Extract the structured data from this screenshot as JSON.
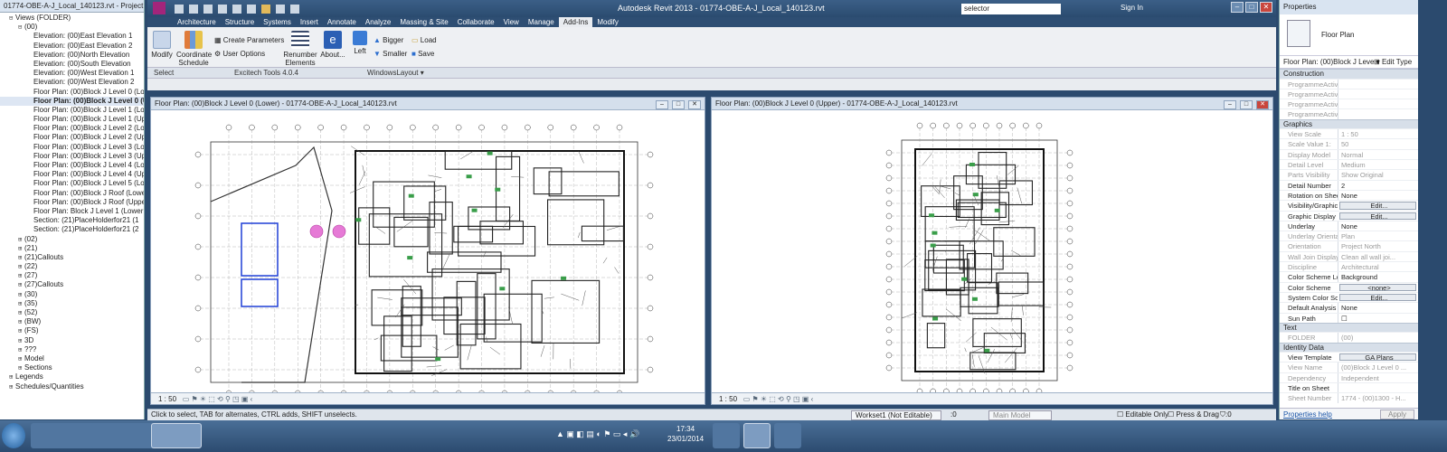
{
  "app": {
    "title": "Autodesk Revit 2013 -      01774-OBE-A-J_Local_140123.rvt",
    "search_value": "selector",
    "sign_in": "Sign In"
  },
  "tabs": [
    "Architecture",
    "Structure",
    "Systems",
    "Insert",
    "Annotate",
    "Analyze",
    "Massing & Site",
    "Collaborate",
    "View",
    "Manage",
    "Add-Ins",
    "Modify"
  ],
  "active_tab": "Add-Ins",
  "ribbon": {
    "modify": "Modify",
    "coordinate": "Coordinate",
    "schedule": "Schedule",
    "create_params": "Create Parameters",
    "user_options": "User Options",
    "renumber": "Renumber",
    "elements": "Elements",
    "about": "About...",
    "left": "Left",
    "bigger": "Bigger",
    "smaller": "Smaller",
    "load": "Load",
    "save": "Save",
    "panel_select": "Select",
    "panel_excitech": "Excitech Tools 4.0.4",
    "panel_windows": "WindowsLayout ▾"
  },
  "project_browser": {
    "title": "01774-OBE-A-J_Local_140123.rvt - Project ...",
    "items": [
      {
        "t": "⊟",
        "l": "Views (FOLDER)",
        "i": 0
      },
      {
        "t": "⊟",
        "l": "(00)",
        "i": 1
      },
      {
        "t": "",
        "l": "Elevation: (00)East Elevation 1",
        "i": 2
      },
      {
        "t": "",
        "l": "Elevation: (00)East Elevation 2",
        "i": 2
      },
      {
        "t": "",
        "l": "Elevation: (00)North Elevation",
        "i": 2
      },
      {
        "t": "",
        "l": "Elevation: (00)South Elevation",
        "i": 2
      },
      {
        "t": "",
        "l": "Elevation: (00)West Elevation 1",
        "i": 2
      },
      {
        "t": "",
        "l": "Elevation: (00)West Elevation 2",
        "i": 2
      },
      {
        "t": "",
        "l": "Floor Plan: (00)Block J Level 0 (Lo",
        "i": 2
      },
      {
        "t": "",
        "l": "Floor Plan: (00)Block J Level 0 (U",
        "i": 2,
        "b": true
      },
      {
        "t": "",
        "l": "Floor Plan: (00)Block J Level 1 (Lo",
        "i": 2
      },
      {
        "t": "",
        "l": "Floor Plan: (00)Block J Level 1 (Up",
        "i": 2
      },
      {
        "t": "",
        "l": "Floor Plan: (00)Block J Level 2 (Lo",
        "i": 2
      },
      {
        "t": "",
        "l": "Floor Plan: (00)Block J Level 2 (Up",
        "i": 2
      },
      {
        "t": "",
        "l": "Floor Plan: (00)Block J Level 3 (Lo",
        "i": 2
      },
      {
        "t": "",
        "l": "Floor Plan: (00)Block J Level 3 (Up",
        "i": 2
      },
      {
        "t": "",
        "l": "Floor Plan: (00)Block J Level 4 (Lo",
        "i": 2
      },
      {
        "t": "",
        "l": "Floor Plan: (00)Block J Level 4 (Up",
        "i": 2
      },
      {
        "t": "",
        "l": "Floor Plan: (00)Block J Level 5 (Lo",
        "i": 2
      },
      {
        "t": "",
        "l": "Floor Plan: (00)Block J Roof (Lowe",
        "i": 2
      },
      {
        "t": "",
        "l": "Floor Plan: (00)Block J Roof (Uppe",
        "i": 2
      },
      {
        "t": "",
        "l": "Floor Plan: Block J Level 1 (Lower",
        "i": 2
      },
      {
        "t": "",
        "l": "Section: (21)PlaceHolderfor21 (1",
        "i": 2
      },
      {
        "t": "",
        "l": "Section: (21)PlaceHolderfor21 (2",
        "i": 2
      },
      {
        "t": "⊞",
        "l": "(02)",
        "i": 1
      },
      {
        "t": "⊞",
        "l": "(21)",
        "i": 1
      },
      {
        "t": "⊞",
        "l": "(21)Callouts",
        "i": 1
      },
      {
        "t": "⊞",
        "l": "(22)",
        "i": 1
      },
      {
        "t": "⊞",
        "l": "(27)",
        "i": 1
      },
      {
        "t": "⊞",
        "l": "(27)Callouts",
        "i": 1
      },
      {
        "t": "⊞",
        "l": "(30)",
        "i": 1
      },
      {
        "t": "⊞",
        "l": "(35)",
        "i": 1
      },
      {
        "t": "⊞",
        "l": "(52)",
        "i": 1
      },
      {
        "t": "⊞",
        "l": "(BW)",
        "i": 1
      },
      {
        "t": "⊞",
        "l": "(FS)",
        "i": 1
      },
      {
        "t": "⊞",
        "l": "3D",
        "i": 1
      },
      {
        "t": "⊞",
        "l": "???",
        "i": 1
      },
      {
        "t": "⊞",
        "l": "Model",
        "i": 1
      },
      {
        "t": "⊞",
        "l": "Sections",
        "i": 1
      },
      {
        "t": "⊞",
        "l": "Legends",
        "i": 0
      },
      {
        "t": "⊞",
        "l": "Schedules/Quantities",
        "i": 0
      }
    ]
  },
  "view_left": {
    "title": "Floor Plan: (00)Block J Level 0 (Lower) - 01774-OBE-A-J_Local_140123.rvt",
    "scale": "1 : 50"
  },
  "view_right": {
    "title": "Floor Plan: (00)Block J Level 0 (Upper) - 01774-OBE-A-J_Local_140123.rvt",
    "scale": "1 : 50"
  },
  "status": {
    "hint": "Click to select, TAB for alternates, CTRL adds, SHIFT unselects.",
    "workset": "Workset1 (Not Editable)",
    "zero": ":0",
    "model": "Main Model",
    "editable_only": "Editable Only",
    "press_drag": "Press & Drag",
    "filter": ":0"
  },
  "properties": {
    "title": "Properties",
    "type": "Floor Plan",
    "selector": "Floor Plan: (00)Block J Leve ▾",
    "edit_type": "Edit Type",
    "groups": [
      {
        "name": "Construction",
        "rows": [
          {
            "k": "ProgrammeActivi...",
            "v": "",
            "g": true
          },
          {
            "k": "ProgrammeActivi...",
            "v": "",
            "g": true
          },
          {
            "k": "ProgrammeActivi...",
            "v": "",
            "g": true
          },
          {
            "k": "ProgrammeActivi...",
            "v": "",
            "g": true
          }
        ]
      },
      {
        "name": "Graphics",
        "rows": [
          {
            "k": "View Scale",
            "v": "1 : 50",
            "g": true
          },
          {
            "k": "Scale Value    1:",
            "v": "50",
            "g": true
          },
          {
            "k": "Display Model",
            "v": "Normal",
            "g": true
          },
          {
            "k": "Detail Level",
            "v": "Medium",
            "g": true
          },
          {
            "k": "Parts Visibility",
            "v": "Show Original",
            "g": true
          },
          {
            "k": "Detail Number",
            "v": "2"
          },
          {
            "k": "Rotation on Sheet",
            "v": "None"
          },
          {
            "k": "Visibility/Graphics...",
            "v": "Edit...",
            "btn": true
          },
          {
            "k": "Graphic Display O...",
            "v": "Edit...",
            "btn": true
          },
          {
            "k": "Underlay",
            "v": "None"
          },
          {
            "k": "Underlay Orientat...",
            "v": "Plan",
            "g": true
          },
          {
            "k": "Orientation",
            "v": "Project North",
            "g": true
          },
          {
            "k": "Wall Join Display",
            "v": "Clean all wall joi...",
            "g": true
          },
          {
            "k": "Discipline",
            "v": "Architectural",
            "g": true
          },
          {
            "k": "Color Scheme Loc...",
            "v": "Background"
          },
          {
            "k": "Color Scheme",
            "v": "<none>",
            "btn": true
          },
          {
            "k": "System Color Sch...",
            "v": "Edit...",
            "btn": true
          },
          {
            "k": "Default Analysis ...",
            "v": "None"
          },
          {
            "k": "Sun Path",
            "v": "☐"
          }
        ]
      },
      {
        "name": "Text",
        "rows": [
          {
            "k": "FOLDER",
            "v": "(00)",
            "g": true
          }
        ]
      },
      {
        "name": "Identity Data",
        "rows": [
          {
            "k": "View Template",
            "v": "GA Plans",
            "btn": true
          },
          {
            "k": "View Name",
            "v": "(00)Block J Level 0 ...",
            "g": true
          },
          {
            "k": "Dependency",
            "v": "Independent",
            "g": true
          },
          {
            "k": "Title on Sheet",
            "v": ""
          },
          {
            "k": "Sheet Number",
            "v": "1774 - (00)1300 - H...",
            "g": true
          }
        ]
      }
    ],
    "help": "Properties help",
    "apply": "Apply"
  },
  "taskbar": {
    "time": "17:34",
    "date": "23/01/2014"
  },
  "colors": {
    "accent": "#2e4e73",
    "active_tab": "#e9ecf0",
    "taskbar": "#3a5c84"
  }
}
